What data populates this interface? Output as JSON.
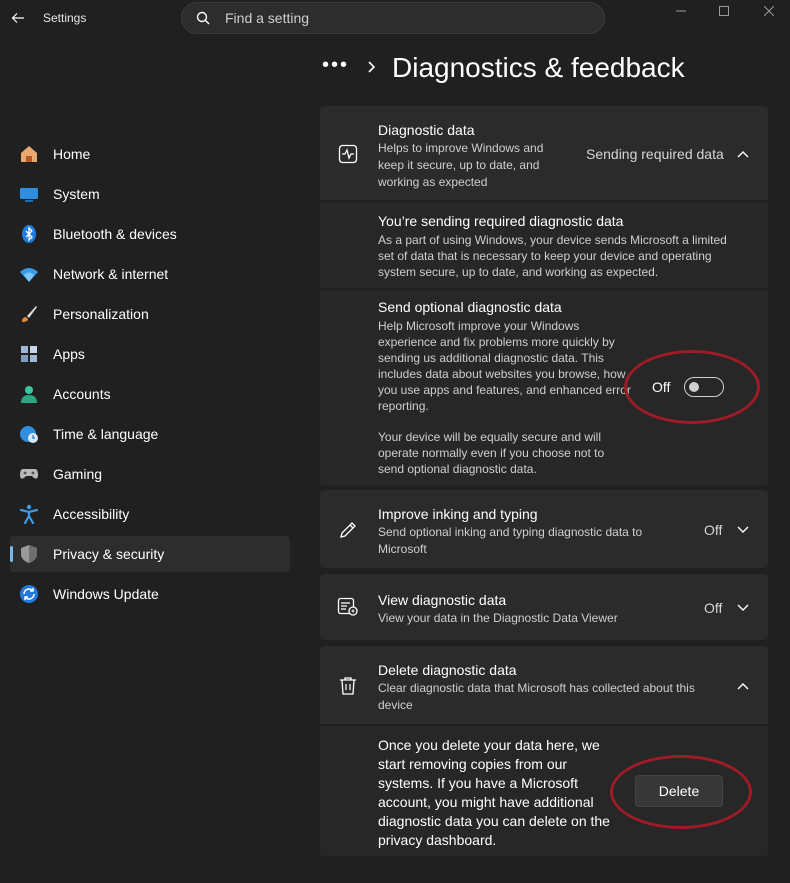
{
  "window": {
    "app_title": "Settings",
    "search_placeholder": "Find a setting"
  },
  "sidebar": {
    "items": [
      {
        "label": "Home",
        "icon": "home-icon"
      },
      {
        "label": "System",
        "icon": "system-icon"
      },
      {
        "label": "Bluetooth & devices",
        "icon": "bluetooth-icon"
      },
      {
        "label": "Network & internet",
        "icon": "wifi-icon"
      },
      {
        "label": "Personalization",
        "icon": "brush-icon"
      },
      {
        "label": "Apps",
        "icon": "apps-icon"
      },
      {
        "label": "Accounts",
        "icon": "account-icon"
      },
      {
        "label": "Time & language",
        "icon": "globe-clock-icon"
      },
      {
        "label": "Gaming",
        "icon": "gamepad-icon"
      },
      {
        "label": "Accessibility",
        "icon": "accessibility-icon"
      },
      {
        "label": "Privacy & security",
        "icon": "shield-icon",
        "active": true
      },
      {
        "label": "Windows Update",
        "icon": "update-icon"
      }
    ]
  },
  "header": {
    "breadcrumb_more": "•••",
    "title": "Diagnostics & feedback"
  },
  "diagnostic_data": {
    "title": "Diagnostic data",
    "description": "Helps to improve Windows and keep it secure, up to date, and working as expected",
    "status": "Sending required data",
    "required": {
      "title": "You’re sending required diagnostic data",
      "description": "As a part of using Windows, your device sends Microsoft a limited set of data that is necessary to keep your device and operating system secure, up to date, and working as expected."
    },
    "optional": {
      "title": "Send optional diagnostic data",
      "description": "Help Microsoft improve your Windows experience and fix problems more quickly by sending us additional diagnostic data. This includes data about websites you browse, how you use apps and features, and enhanced error reporting.",
      "note": "Your device will be equally secure and will operate normally even if you choose not to send optional diagnostic data.",
      "toggle_label": "Off",
      "toggle_on": false
    }
  },
  "inking": {
    "title": "Improve inking and typing",
    "description": "Send optional inking and typing diagnostic data to Microsoft",
    "status": "Off"
  },
  "view_data": {
    "title": "View diagnostic data",
    "description": "View your data in the Diagnostic Data Viewer",
    "status": "Off"
  },
  "delete_data": {
    "title": "Delete diagnostic data",
    "description": "Clear diagnostic data that Microsoft has collected about this device",
    "body": "Once you delete your data here, we start removing copies from our systems. If you have a Microsoft account, you might have additional diagnostic data you can delete on the privacy dashboard.",
    "button_label": "Delete"
  },
  "colors": {
    "background": "#202020",
    "card": "#2b2b2b",
    "accent": "#76b9ed",
    "annotation": "#9d1c26"
  }
}
